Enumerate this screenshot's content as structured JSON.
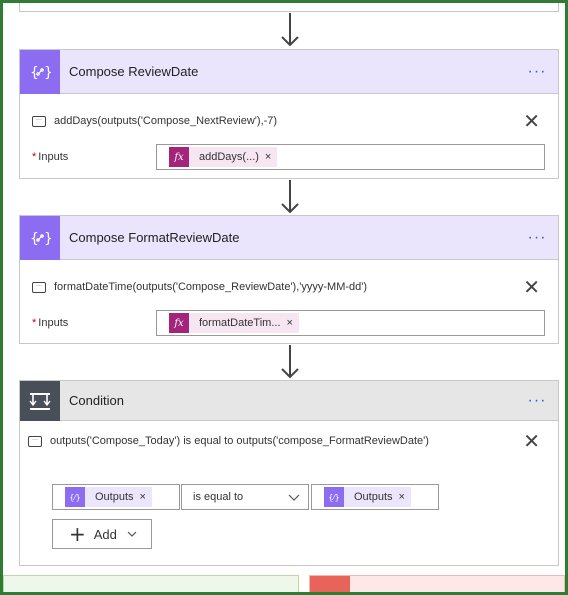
{
  "compose_review": {
    "title": "Compose ReviewDate",
    "comment": "addDays(outputs('Compose_NextReview'),-7)",
    "field_label": "Inputs",
    "token": "addDays(...)"
  },
  "compose_format": {
    "title": "Compose FormatReviewDate",
    "comment": "formatDateTime(outputs('Compose_ReviewDate'),'yyyy-MM-dd')",
    "field_label": "Inputs",
    "token": "formatDateTim..."
  },
  "condition": {
    "title": "Condition",
    "comment": "outputs('Compose_Today') is equal to outputs('compose_FormatReviewDate')",
    "left_token": "Outputs",
    "operator": "is equal to",
    "right_token": "Outputs",
    "add_label": "Add"
  },
  "glyphs": {
    "more": "···",
    "close": "✕",
    "token_close": "×",
    "star": "*",
    "fx": "fx",
    "plus": "+",
    "chevron": "⌵"
  },
  "colors": {
    "compose_accent": "#8c6cf0",
    "condition_accent": "#484f58",
    "expression_token": "#a3247a",
    "frame_border": "#2e7d32",
    "yes_branch": "#eef7ea",
    "no_branch": "#fde7e7"
  }
}
